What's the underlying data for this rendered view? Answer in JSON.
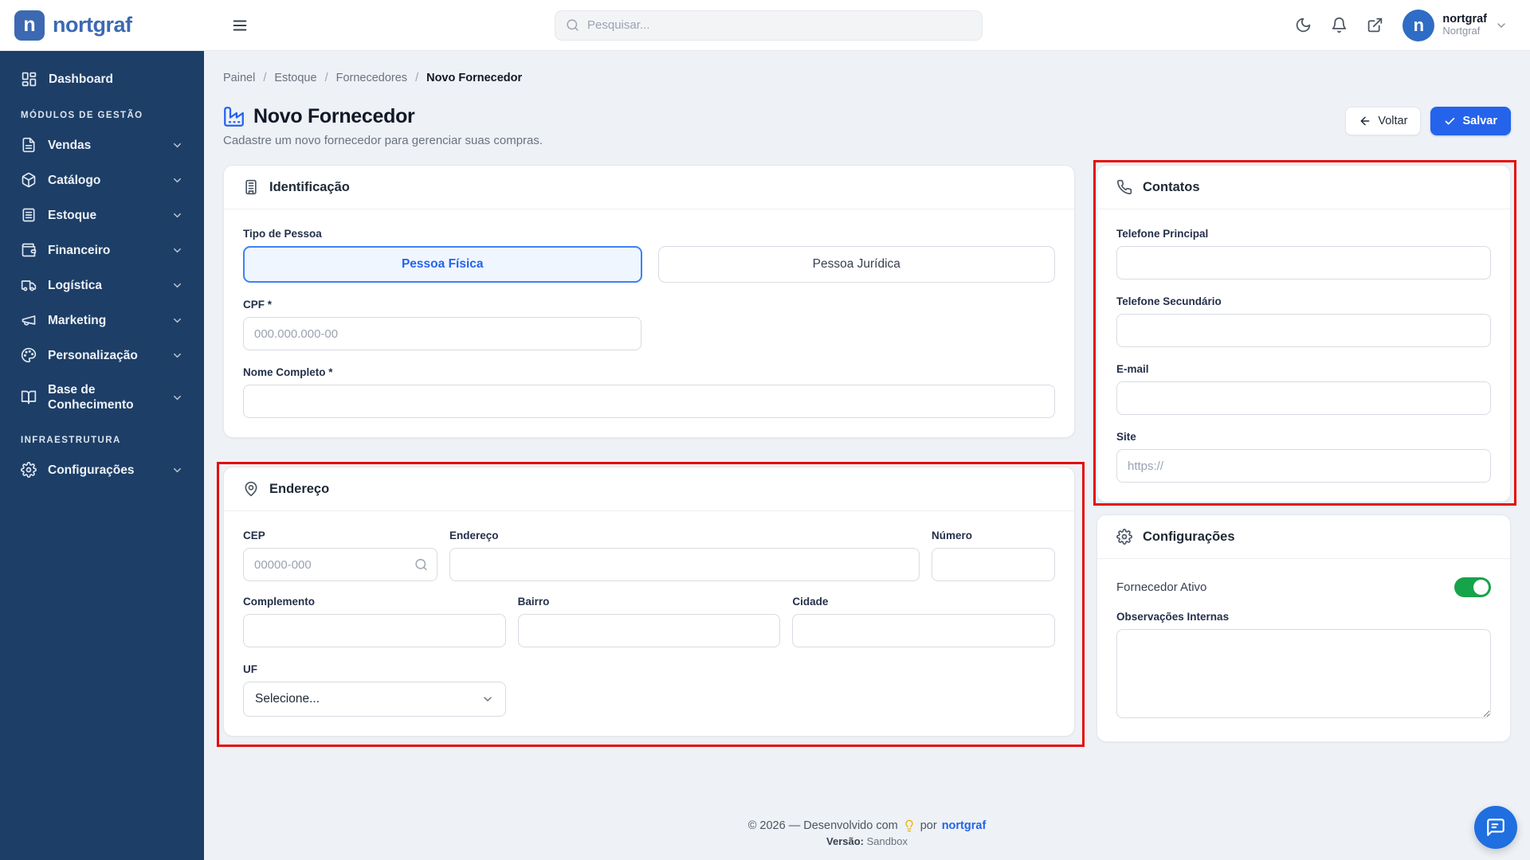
{
  "brand": {
    "name": "nortgraf",
    "logo_letter": "n"
  },
  "topbar": {
    "search_placeholder": "Pesquisar...",
    "user_name": "nortgraf",
    "user_org": "Nortgraf",
    "avatar_letter": "n"
  },
  "sidebar": {
    "dashboard": "Dashboard",
    "groups": [
      {
        "label": "MÓDULOS DE GESTÃO",
        "items": [
          {
            "label": "Vendas"
          },
          {
            "label": "Catálogo"
          },
          {
            "label": "Estoque"
          },
          {
            "label": "Financeiro"
          },
          {
            "label": "Logística"
          },
          {
            "label": "Marketing"
          },
          {
            "label": "Personalização"
          },
          {
            "label": "Base de Conhecimento"
          }
        ]
      },
      {
        "label": "INFRAESTRUTURA",
        "items": [
          {
            "label": "Configurações"
          }
        ]
      }
    ]
  },
  "breadcrumb": {
    "items": [
      "Painel",
      "Estoque",
      "Fornecedores",
      "Novo Fornecedor"
    ],
    "separator": "/"
  },
  "page": {
    "title": "Novo Fornecedor",
    "subtitle": "Cadastre um novo fornecedor para gerenciar suas compras.",
    "back_label": "Voltar",
    "save_label": "Salvar"
  },
  "identification": {
    "title": "Identificação",
    "person_type_label": "Tipo de Pessoa",
    "person_types": [
      "Pessoa Física",
      "Pessoa Jurídica"
    ],
    "selected_person_type": "Pessoa Física",
    "cpf_label": "CPF *",
    "cpf_placeholder": "000.000.000-00",
    "name_label": "Nome Completo *"
  },
  "address": {
    "title": "Endereço",
    "cep_label": "CEP",
    "cep_placeholder": "00000-000",
    "street_label": "Endereço",
    "number_label": "Número",
    "complement_label": "Complemento",
    "district_label": "Bairro",
    "city_label": "Cidade",
    "uf_label": "UF",
    "uf_value": "Selecione..."
  },
  "contacts": {
    "title": "Contatos",
    "phone_primary_label": "Telefone Principal",
    "phone_secondary_label": "Telefone Secundário",
    "email_label": "E-mail",
    "site_label": "Site",
    "site_placeholder": "https://"
  },
  "settings_card": {
    "title": "Configurações",
    "active_label": "Fornecedor Ativo",
    "active_state": "on",
    "notes_label": "Observações Internas"
  },
  "footer": {
    "line1_prefix": "© 2026 — Desenvolvido com",
    "line1_middle": "por",
    "line1_link": "nortgraf",
    "version_label": "Versão:",
    "version_value": "Sandbox"
  },
  "colors": {
    "sidebar_bg": "#1d3e66",
    "brand_blue": "#3d69b2",
    "accent_blue": "#2563eb",
    "selected_bg": "#eff6ff",
    "toggle_green": "#17a34a",
    "annotation_red": "#e30b0b",
    "page_bg": "#eef1f5"
  }
}
